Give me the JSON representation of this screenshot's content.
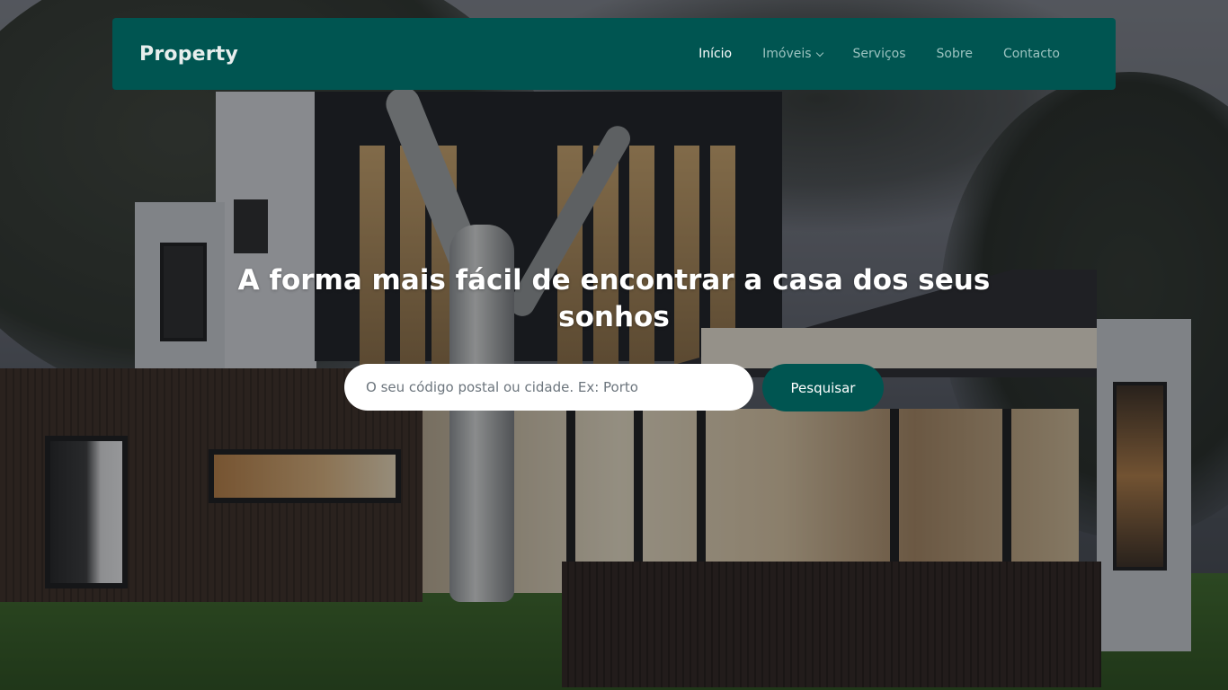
{
  "brand": "Property",
  "nav": {
    "items": [
      {
        "label": "Início",
        "active": true
      },
      {
        "label": "Imóveis",
        "dropdown": true
      },
      {
        "label": "Serviços"
      },
      {
        "label": "Sobre"
      },
      {
        "label": "Contacto"
      }
    ]
  },
  "hero": {
    "title": "A forma mais fácil de encontrar a casa dos seus sonhos",
    "search_placeholder": "O seu código postal ou cidade. Ex: Porto",
    "search_button": "Pesquisar"
  },
  "colors": {
    "primary": "#005551",
    "nav_text": "#9cc3c0",
    "nav_active": "#ffffff"
  }
}
